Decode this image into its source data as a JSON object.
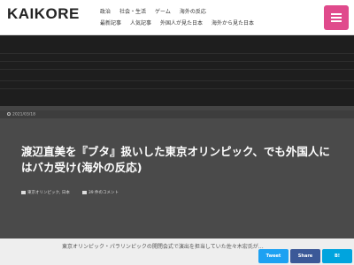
{
  "header": {
    "logo": "KAIKORE",
    "tagline": "",
    "nav_row1": [
      "政治",
      "社会・生活",
      "ゲーム",
      "海外の反応"
    ],
    "nav_row2": [
      "最新記事",
      "人気記事",
      "外国人が見た日本",
      "海外から見た日本"
    ]
  },
  "headlines": {
    "label": "",
    "items": [
      "",
      "",
      "",
      "",
      ""
    ]
  },
  "hero": {
    "date": "2021/03/18",
    "breadcrumb": "",
    "category": "",
    "title": "渡辺直美を『ブタ』扱いした東京オリンピック、でも外国人にはバカ受け(海外の反応)",
    "meta": {
      "tag_label": "東京オリンピック, 日本",
      "comments_label": "39 件のコメント"
    }
  },
  "article": {
    "snippet": "東京オリンピック・パラリンピックの開閉会式で演出を担当していた佐々木宏氏が…"
  },
  "share": {
    "twitter": "Tweet",
    "facebook": "Share",
    "hatena": "B!"
  },
  "colors": {
    "accent": "#e04a8c",
    "dark_bg": "#1e1e1e",
    "hero_bg": "#4a4a4a"
  }
}
